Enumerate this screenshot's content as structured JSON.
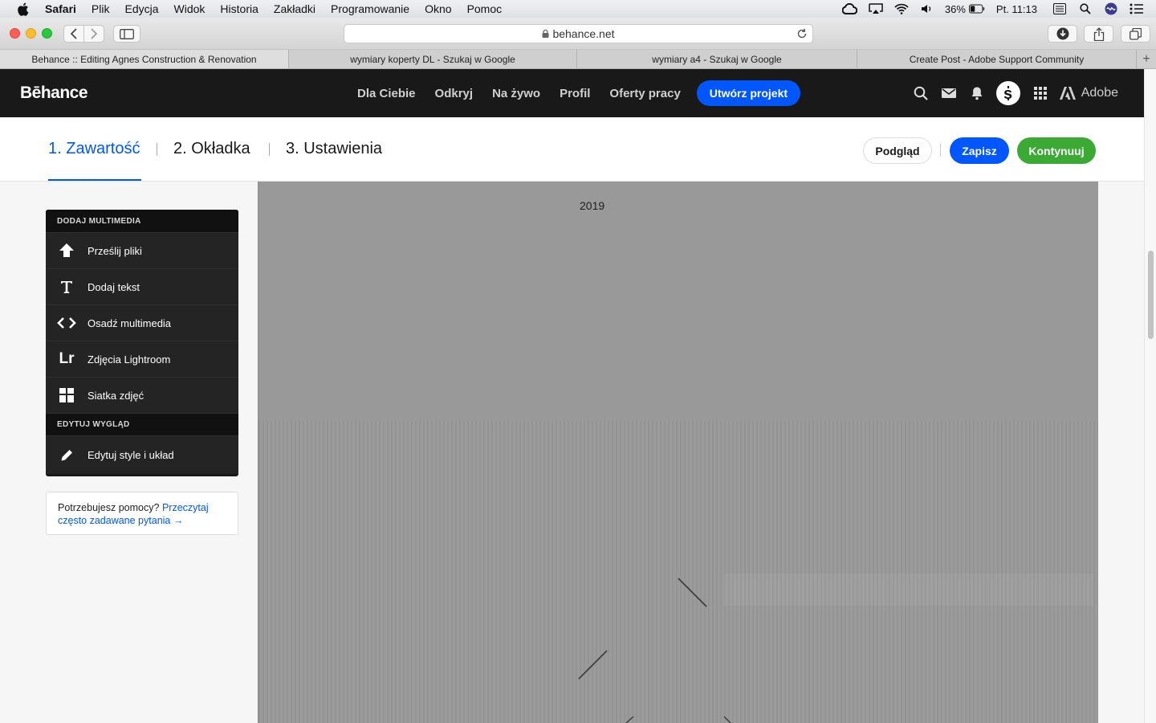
{
  "menubar": {
    "items": [
      "Safari",
      "Plik",
      "Edycja",
      "Widok",
      "Historia",
      "Zakładki",
      "Programowanie",
      "Okno",
      "Pomoc"
    ],
    "battery": "36%",
    "clock": "Pt. 11:13"
  },
  "browser": {
    "address": "behance.net",
    "tabs": [
      {
        "label": "Behance :: Editing Agnes Construction & Renovation",
        "active": true
      },
      {
        "label": "wymiary koperty DL - Szukaj w Google",
        "active": false
      },
      {
        "label": "wymiary a4 - Szukaj w Google",
        "active": false
      },
      {
        "label": "Create Post - Adobe Support Community",
        "active": false
      }
    ],
    "new_tab": "+"
  },
  "header": {
    "logo": "Bēhance",
    "nav": [
      "Dla Ciebie",
      "Odkryj",
      "Na żywo",
      "Profil",
      "Oferty pracy"
    ],
    "create_button": "Utwórz projekt",
    "adobe_label": "Adobe",
    "icons": [
      "search-icon",
      "mail-icon",
      "bell-icon",
      "avatar",
      "apps-grid-icon",
      "adobe-logo-icon"
    ]
  },
  "editor": {
    "steps": [
      "1. Zawartość",
      "2. Okładka",
      "3. Ustawienia"
    ],
    "active_step": 0,
    "preview_button": "Podgląd",
    "save_button": "Zapisz",
    "continue_button": "Kontynuuj"
  },
  "sidebar": {
    "add_media_heading": "DODAJ MULTIMEDIA",
    "media_items": [
      {
        "label": "Prześlij pliki",
        "icon": "upload-arrow-icon"
      },
      {
        "label": "Dodaj tekst",
        "icon": "text-icon"
      },
      {
        "label": "Osadź multimedia",
        "icon": "embed-code-icon"
      },
      {
        "label": "Zdjęcia Lightroom",
        "icon": "lightroom-icon"
      },
      {
        "label": "Siatka zdjęć",
        "icon": "photo-grid-icon"
      }
    ],
    "edit_heading": "EDYTUJ WYGLĄD",
    "edit_item": {
      "label": "Edytuj style i układ",
      "icon": "pencil-icon"
    },
    "help_text": "Potrzebujesz pomocy?",
    "help_link": "Przeczytaj często zadawane pytania →",
    "lightroom_glyph": "Lr"
  },
  "canvas": {
    "year": "2019",
    "background": "#999999"
  }
}
